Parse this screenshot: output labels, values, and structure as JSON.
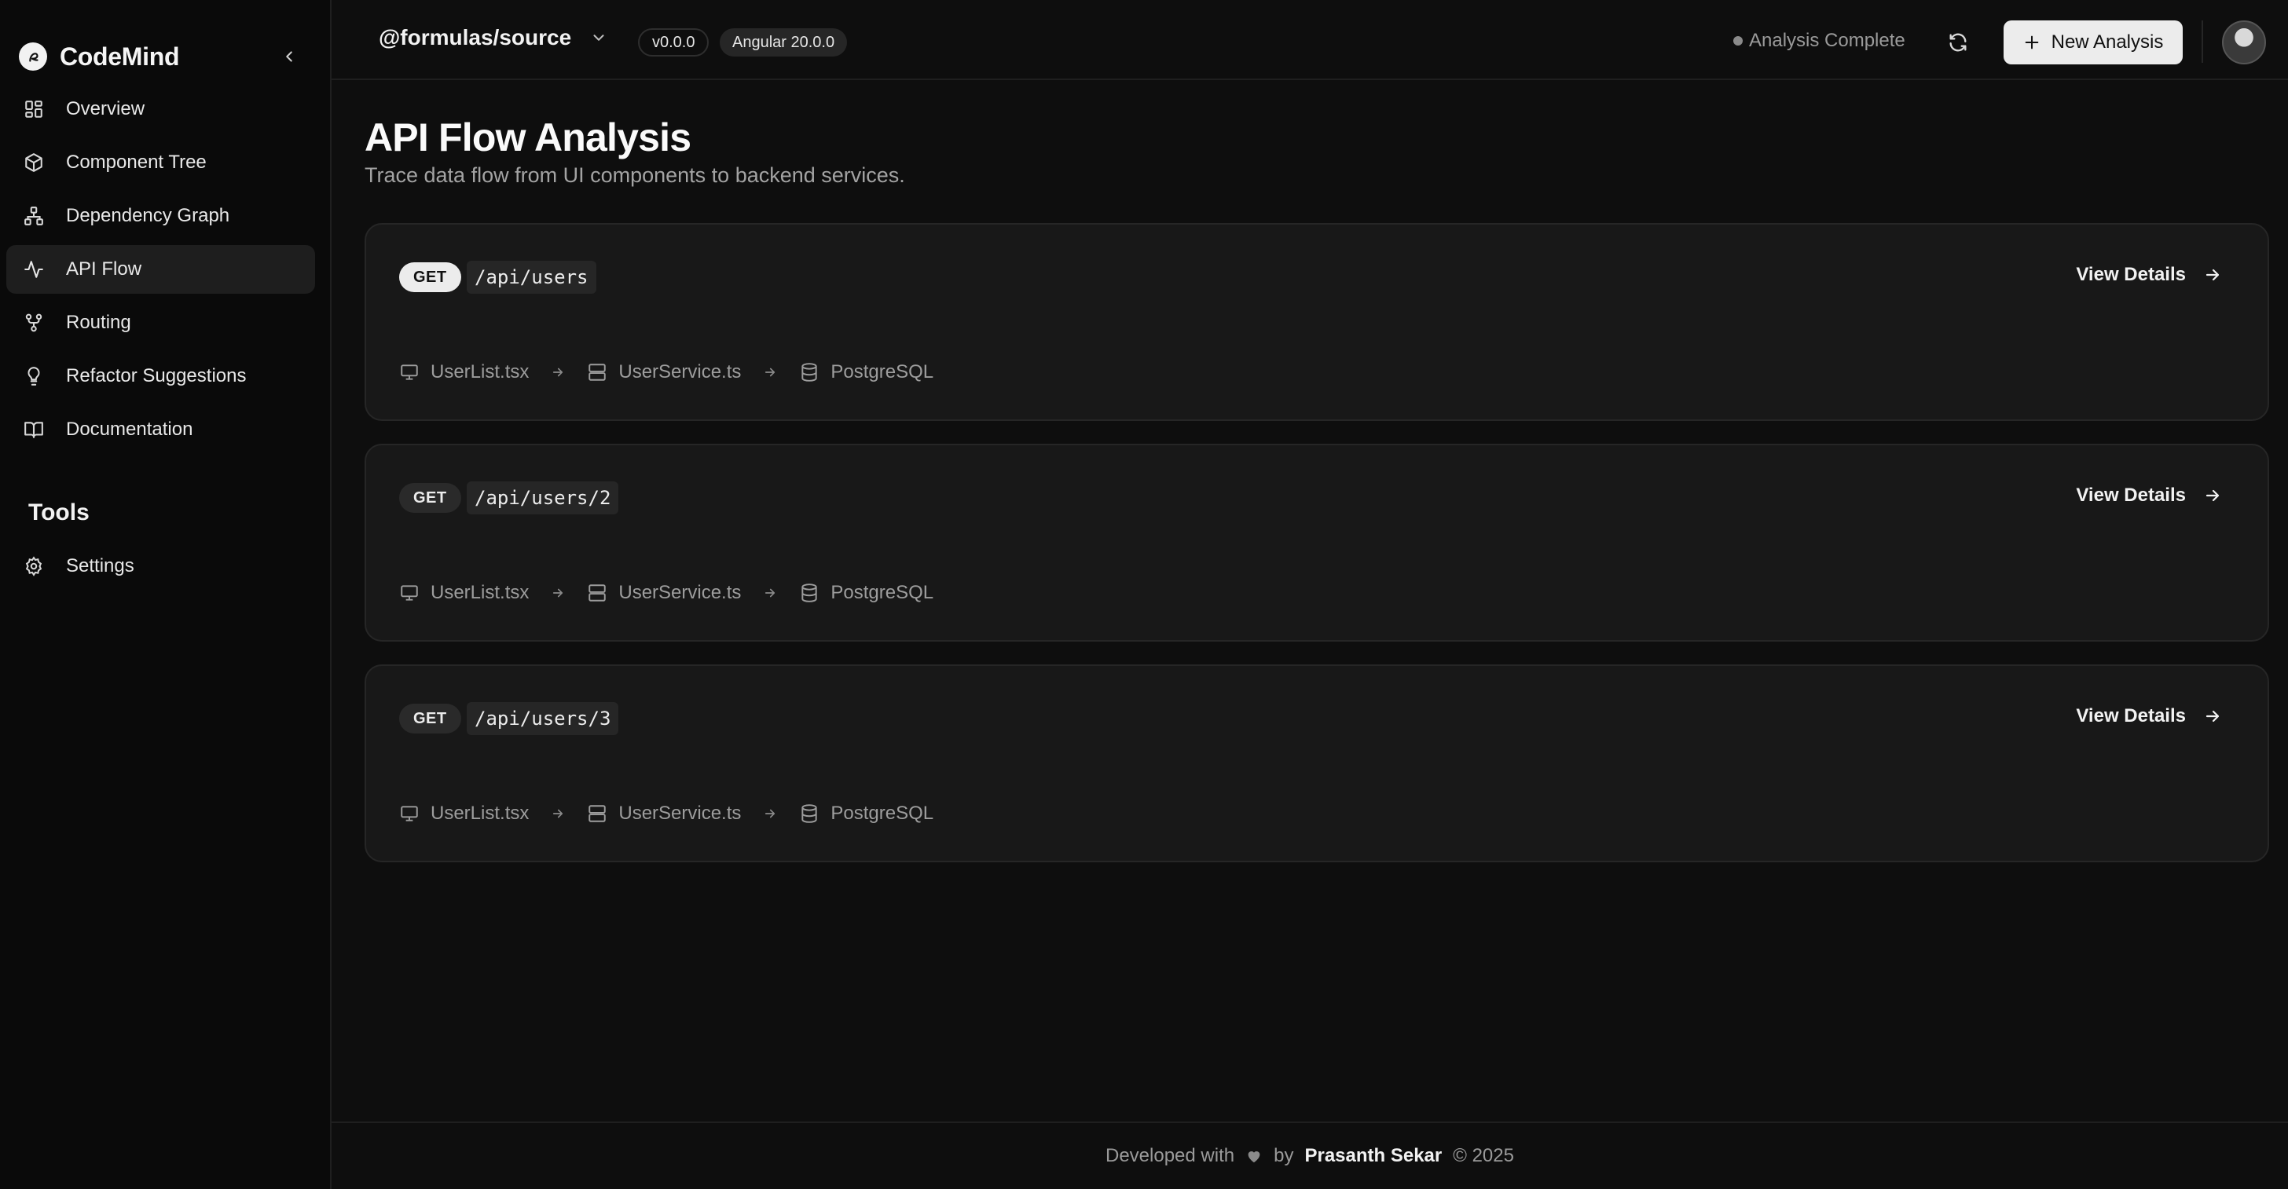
{
  "brand": {
    "name": "CodeMind"
  },
  "sidebar": {
    "items": [
      {
        "label": "Overview",
        "icon": "grid-icon",
        "active": false
      },
      {
        "label": "Component Tree",
        "icon": "cube-icon",
        "active": false
      },
      {
        "label": "Dependency Graph",
        "icon": "network-icon",
        "active": false
      },
      {
        "label": "API Flow",
        "icon": "activity-icon",
        "active": true
      },
      {
        "label": "Routing",
        "icon": "git-fork-icon",
        "active": false
      },
      {
        "label": "Refactor Suggestions",
        "icon": "lightbulb-icon",
        "active": false
      },
      {
        "label": "Documentation",
        "icon": "book-icon",
        "active": false
      }
    ],
    "tools_title": "Tools",
    "tools": [
      {
        "label": "Settings",
        "icon": "gear-icon"
      }
    ]
  },
  "header": {
    "project": "@formulas/source",
    "version": "v0.0.0",
    "framework": "Angular 20.0.0",
    "status": "Analysis Complete",
    "new_analysis_label": "New Analysis"
  },
  "page": {
    "title": "API Flow Analysis",
    "subtitle": "Trace data flow from UI components to backend services."
  },
  "flows": [
    {
      "method": "GET",
      "endpoint": "/api/users",
      "details_label": "View Details",
      "steps": [
        "UserList.tsx",
        "UserService.ts",
        "PostgreSQL"
      ]
    },
    {
      "method": "GET",
      "endpoint": "/api/users/2",
      "details_label": "View Details",
      "steps": [
        "UserList.tsx",
        "UserService.ts",
        "PostgreSQL"
      ]
    },
    {
      "method": "GET",
      "endpoint": "/api/users/3",
      "details_label": "View Details",
      "steps": [
        "UserList.tsx",
        "UserService.ts",
        "PostgreSQL"
      ]
    }
  ],
  "footer": {
    "prefix": "Developed with",
    "by": "by",
    "author": "Prasanth Sekar",
    "copyright": "© 2025"
  },
  "colors": {
    "background": "#0e0e0e",
    "sidebar": "#0a0a0a",
    "card": "#181818",
    "accent_button": "#ececec"
  }
}
